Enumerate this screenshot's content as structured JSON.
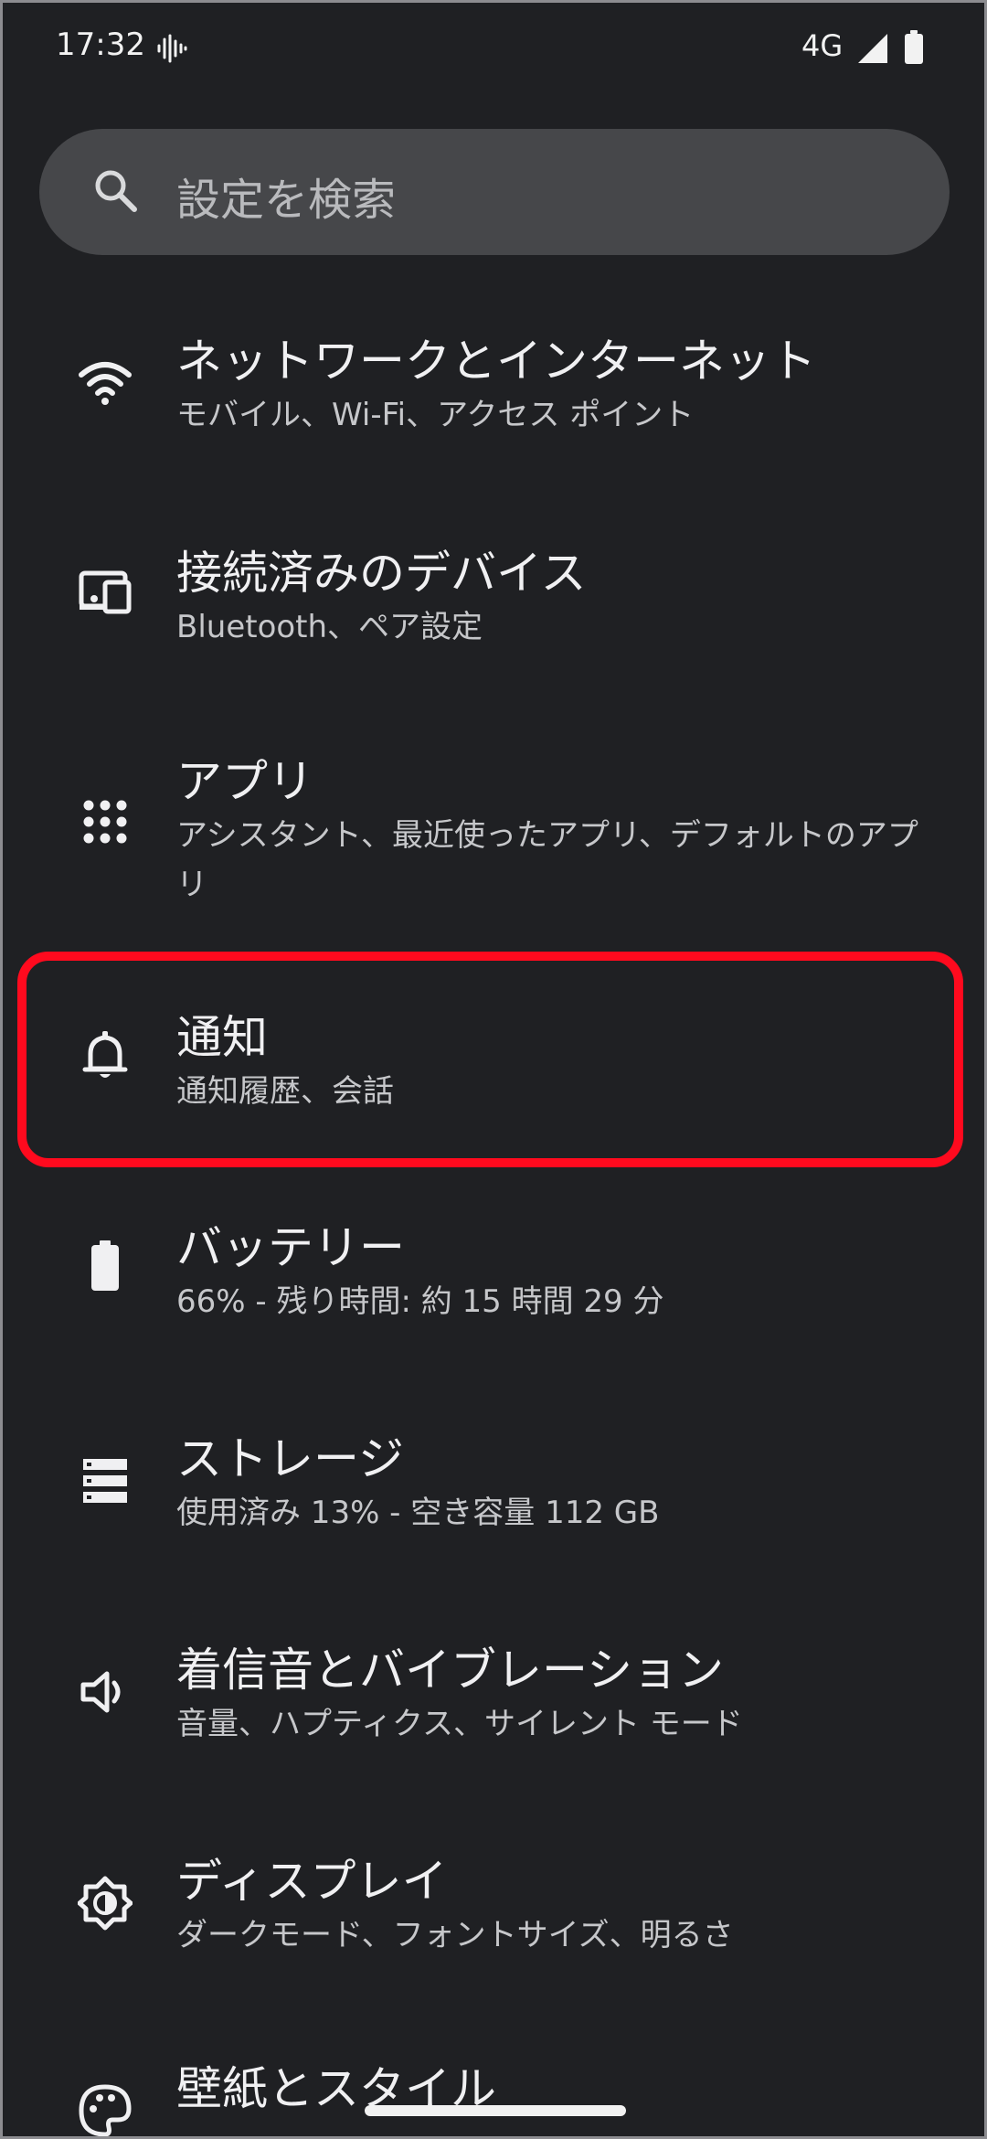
{
  "status_bar": {
    "time": "17:32",
    "network": "4G"
  },
  "search": {
    "placeholder": "設定を検索"
  },
  "settings_items": [
    {
      "title": "ネットワークとインターネット",
      "subtitle": "モバイル、Wi-Fi、アクセス ポイント",
      "icon": "wifi-icon"
    },
    {
      "title": "接続済みのデバイス",
      "subtitle": "Bluetooth、ペア設定",
      "icon": "connected-devices-icon"
    },
    {
      "title": "アプリ",
      "subtitle": "アシスタント、最近使ったアプリ、デフォルトのアプリ",
      "icon": "apps-grid-icon"
    },
    {
      "title": "通知",
      "subtitle": "通知履歴、会話",
      "icon": "bell-icon"
    },
    {
      "title": "バッテリー",
      "subtitle": "66% - 残り時間: 約 15 時間 29 分",
      "icon": "battery-icon"
    },
    {
      "title": "ストレージ",
      "subtitle": "使用済み 13% - 空き容量 112 GB",
      "icon": "storage-icon"
    },
    {
      "title": "着信音とバイブレーション",
      "subtitle": "音量、ハプティクス、サイレント モード",
      "icon": "volume-icon"
    },
    {
      "title": "ディスプレイ",
      "subtitle": "ダークモード、フォントサイズ、明るさ",
      "icon": "brightness-icon"
    },
    {
      "title": "壁紙とスタイル",
      "subtitle": "",
      "icon": "palette-icon"
    }
  ],
  "colors": {
    "background": "#1f2023",
    "search_bg": "#46474a",
    "highlight": "#ff0a1e"
  }
}
